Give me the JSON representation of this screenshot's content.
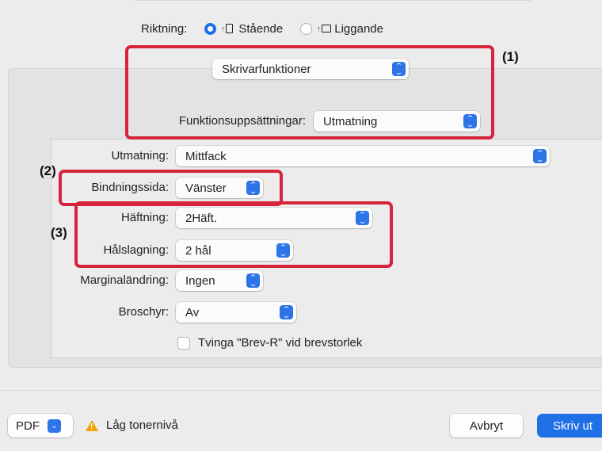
{
  "orientation": {
    "label": "Riktning:",
    "options": [
      {
        "label": "Stående",
        "selected": true
      },
      {
        "label": "Liggande",
        "selected": false
      }
    ]
  },
  "preset_popup": {
    "value": "Skrivarfunktioner"
  },
  "feature_sets": {
    "label": "Funktionsuppsättningar:",
    "value": "Utmatning"
  },
  "settings": {
    "output": {
      "label": "Utmatning:",
      "value": "Mittfack"
    },
    "binding_side": {
      "label": "Bindningssida:",
      "value": "Vänster"
    },
    "stapling": {
      "label": "Häftning:",
      "value": "2Häft."
    },
    "punching": {
      "label": "Hålslagning:",
      "value": "2 hål"
    },
    "margin_shift": {
      "label": "Marginaländring:",
      "value": "Ingen"
    },
    "booklet": {
      "label": "Broschyr:",
      "value": "Av"
    },
    "force_letter": {
      "label": "Tvinga \"Brev-R\" vid brevstorlek",
      "checked": false
    }
  },
  "callouts": {
    "c1": "(1)",
    "c2": "(2)",
    "c3": "(3)"
  },
  "footer": {
    "pdf_label": "PDF",
    "warning_text": "Låg tonernivå",
    "cancel_label": "Avbryt",
    "print_label": "Skriv ut"
  },
  "colors": {
    "accent": "#1f6fe5",
    "callout_red": "#d7243a",
    "warning": "#f0a400"
  }
}
